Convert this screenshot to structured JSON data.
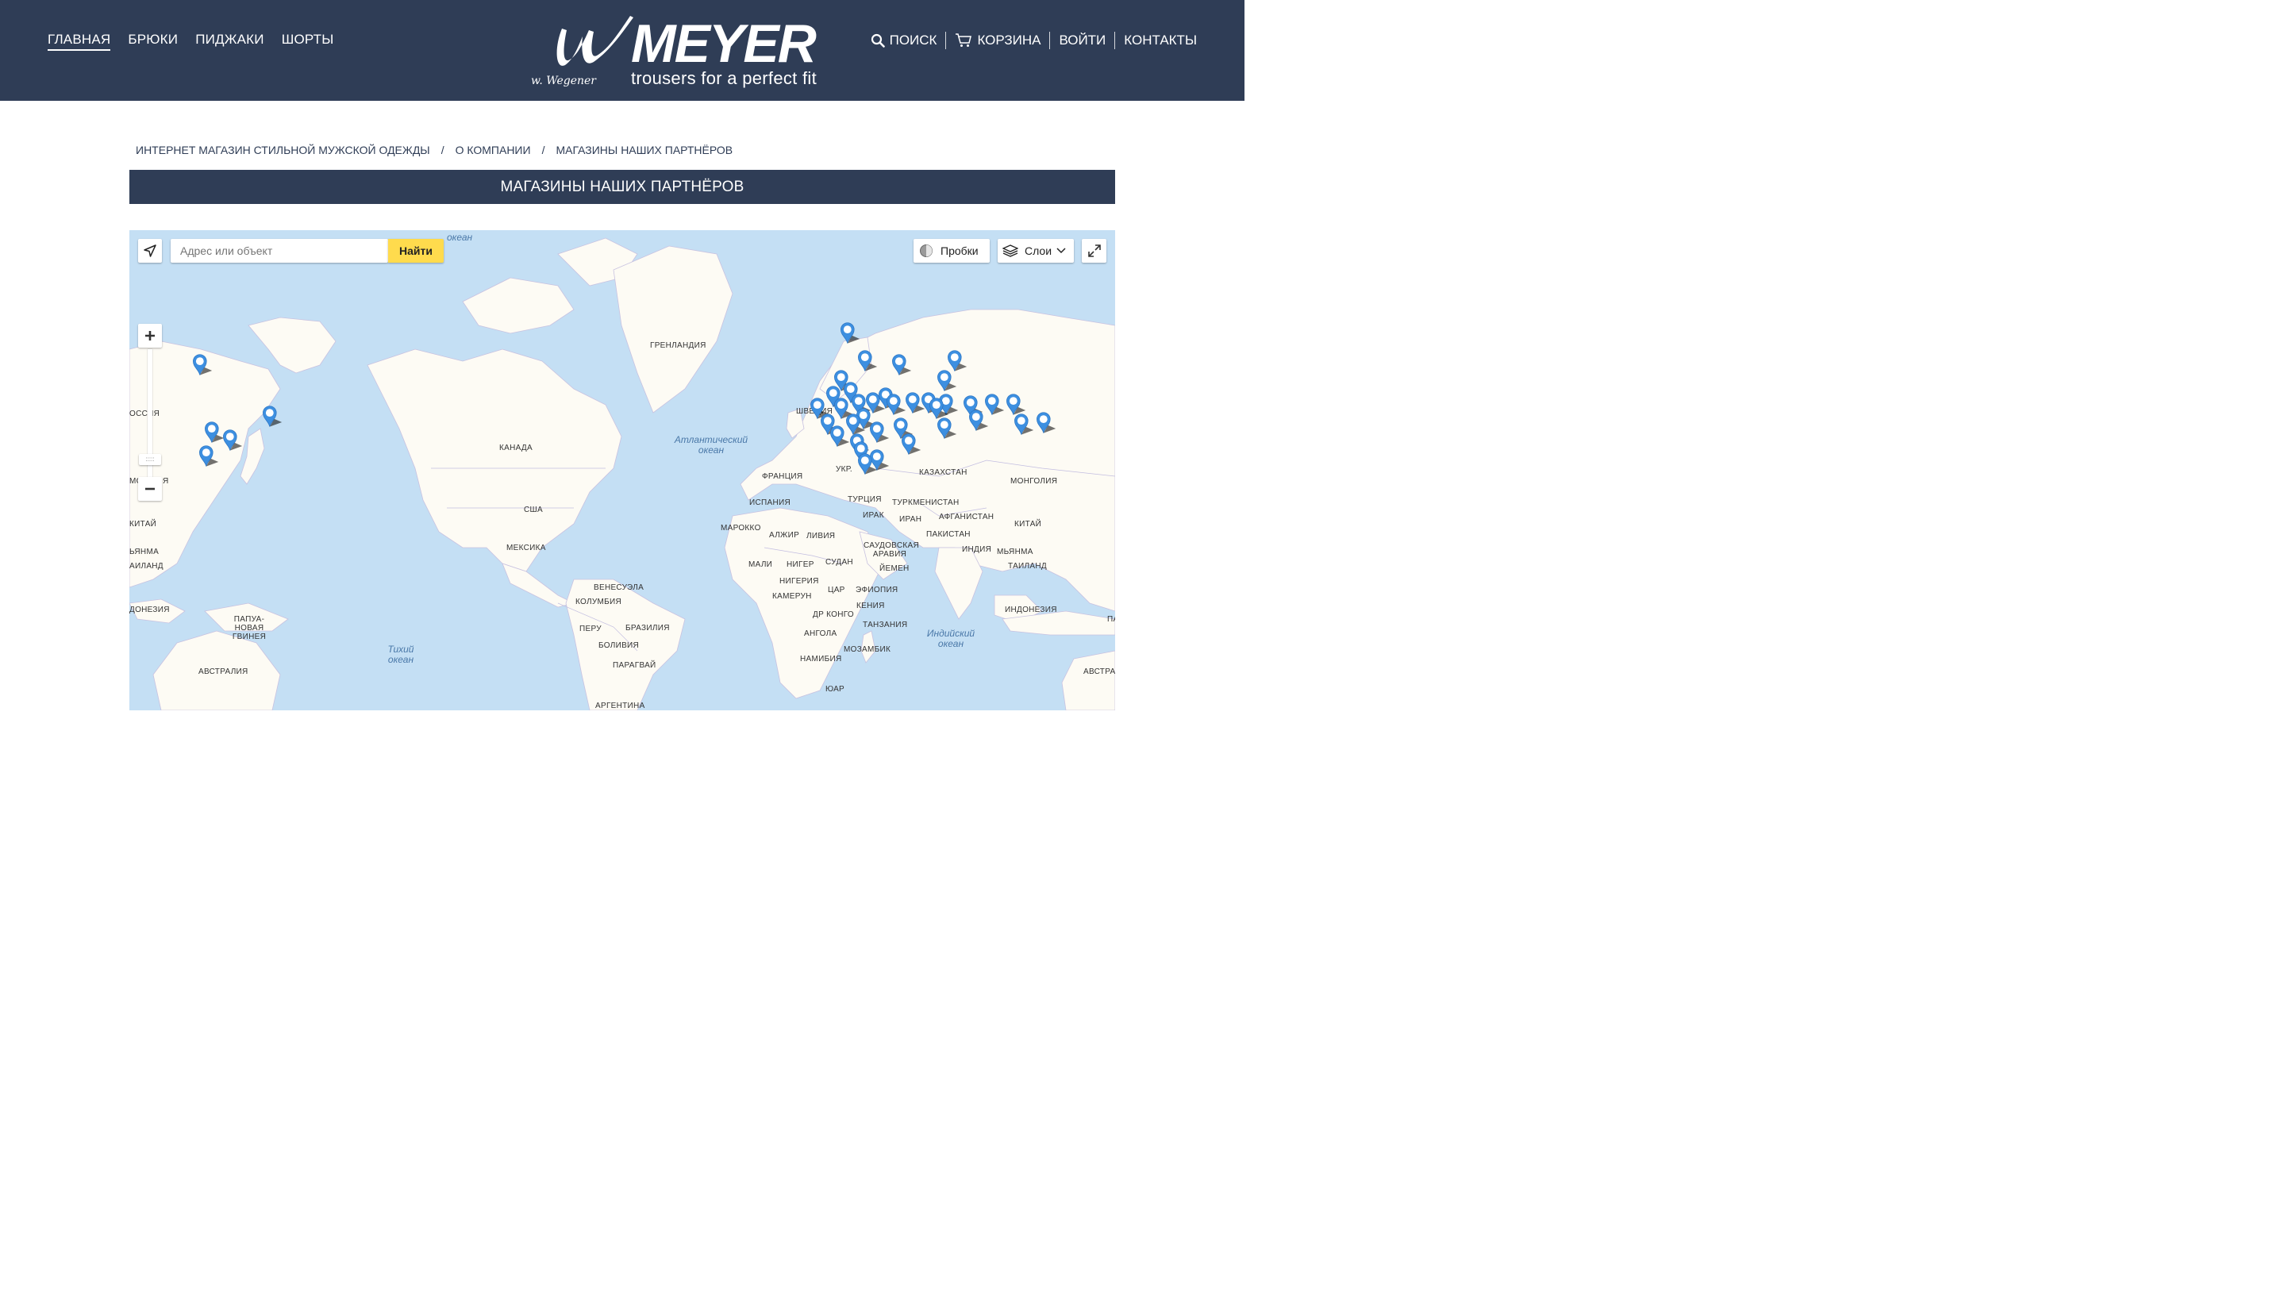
{
  "nav": {
    "left": [
      "ГЛАВНАЯ",
      "БРЮКИ",
      "ПИДЖАКИ",
      "ШОРТЫ"
    ],
    "search": "ПОИСК",
    "cart": "КОРЗИНА",
    "login": "ВОЙТИ",
    "contacts": "КОНТАКТЫ"
  },
  "logo": {
    "brand": "MEYER",
    "tagline": "trousers for a perfect fit",
    "signature": "w. Wegener"
  },
  "breadcrumb": [
    "ИНТЕРНЕТ МАГАЗИН СТИЛЬНОЙ МУЖСКОЙ ОДЕЖДЫ",
    "О КОМПАНИИ",
    "МАГАЗИНЫ НАШИХ ПАРТНЁРОВ"
  ],
  "page_title": "МАГАЗИНЫ НАШИХ ПАРТНЁРОВ",
  "map": {
    "search_placeholder": "Адрес или объект",
    "find_button": "Найти",
    "traffic": "Пробки",
    "layers": "Слои",
    "labels": {
      "top_ocean": "океан",
      "greenland": "ГРЕНЛАНДИЯ",
      "russia_left": "ОССИЯ",
      "canada": "КАНАДА",
      "usa": "США",
      "mexico": "МЕКСИКА",
      "sweden": "ШВЕЦИЯ",
      "france": "ФРАНЦИЯ",
      "spain": "ИСПАНИЯ",
      "ukraine": "УКР.",
      "turkey": "ТУРЦИЯ",
      "kazakhstan": "КАЗАХСТАН",
      "turkmenistan": "ТУРКМЕНИСТАН",
      "mongolia": "МОНГОЛИЯ",
      "iraq": "ИРАК",
      "iran": "ИРАН",
      "afghanistan": "АФГАНИСТАН",
      "pakistan": "ПАКИСТАН",
      "china_right": "КИТАЙ",
      "china_left": "КИТАЙ",
      "morocco": "МАРОККО",
      "algeria": "АЛЖИР",
      "libya": "ЛИВИЯ",
      "saudi": "САУДОВСКАЯ АРАВИЯ",
      "india": "ИНДИЯ",
      "myanmar_right": "МЬЯНМА",
      "myanmar_left": "ЬЯНМА",
      "mali": "МАЛИ",
      "niger": "НИГЕР",
      "sudan": "СУДАН",
      "yemen": "ЙЕМЕН",
      "thailand_right": "ТАИЛАНД",
      "thailand_left": "АИЛАНД",
      "nigeria": "НИГЕРИЯ",
      "car": "ЦАР",
      "ethiopia": "ЭФИОПИЯ",
      "cameroon": "КАМЕРУН",
      "kenya": "КЕНИЯ",
      "drc": "ДР КОНГО",
      "tanzania": "ТАНЗАНИЯ",
      "angola": "АНГОЛА",
      "mozambique": "МОЗАМБИК",
      "namibia": "НАМИБИЯ",
      "sar": "ЮАР",
      "indonesia_right": "ИНДОНЕЗИЯ",
      "indonesia_left": "ДОНЕЗИЯ",
      "png": "ПАПУА-НОВАЯ ГВИНЕЯ",
      "australia_left": "АВСТРАЛИЯ",
      "australia_right": "АВСТРАЛ",
      "venezuela": "ВЕНЕСУЭЛА",
      "colombia": "КОЛУМБИЯ",
      "peru": "ПЕРУ",
      "brazil": "БРАЗИЛИЯ",
      "bolivia": "БОЛИВИЯ",
      "paraguay": "ПАРАГВАЙ",
      "argentina": "АРГЕНТИНА",
      "atlantic": "Атлантический океан",
      "pacific": "Тихий океан",
      "indian": "Индийский океан",
      "edge_pa": "ПА",
      "mo_left": "МО",
      "ya_left": "Я"
    }
  },
  "colors": {
    "header": "#2f3d56",
    "find_button": "#ffdb4d",
    "water": "#c4dff4",
    "land": "#fdfbf4",
    "pin": "#3d8fe0"
  }
}
